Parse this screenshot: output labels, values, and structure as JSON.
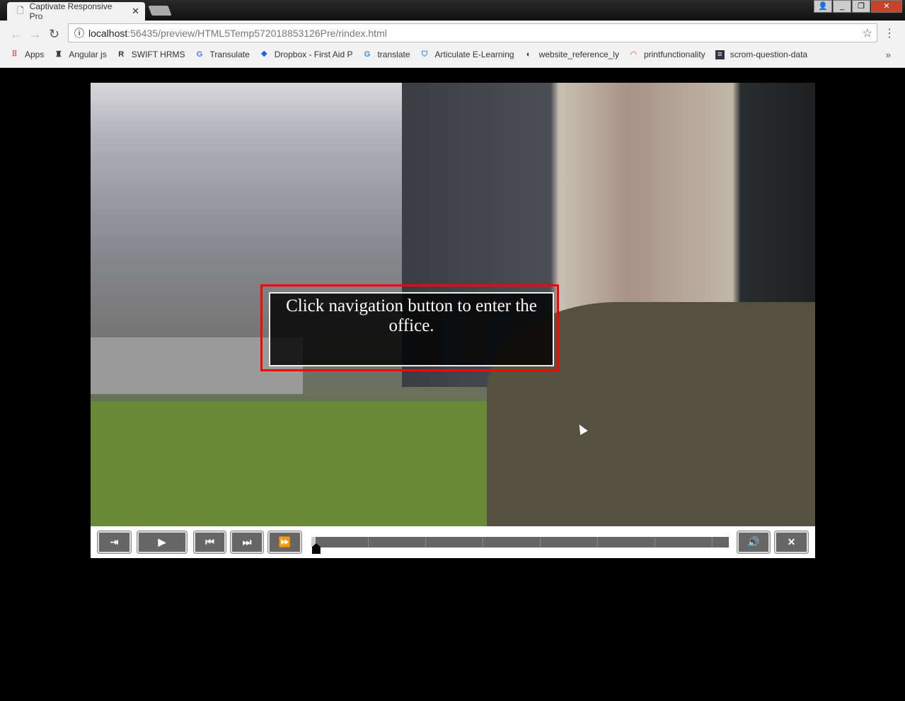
{
  "browser": {
    "tab_title": "Captivate Responsive Pro",
    "url_host": "localhost",
    "url_path": ":56435/preview/HTML5Temp572018853126Pre/rindex.html",
    "bookmarks": [
      {
        "label": "Apps",
        "icon": "apps-grid-icon"
      },
      {
        "label": "Angular js",
        "icon": "angular-icon"
      },
      {
        "label": "SWIFT HRMS",
        "icon": "r-icon"
      },
      {
        "label": "Transulate",
        "icon": "google-icon"
      },
      {
        "label": "Dropbox - First Aid P",
        "icon": "dropbox-icon"
      },
      {
        "label": "translate",
        "icon": "google-icon"
      },
      {
        "label": "Articulate E-Learning",
        "icon": "shield-icon"
      },
      {
        "label": "website_reference_ly",
        "icon": "globe-icon"
      },
      {
        "label": "printfunctionality",
        "icon": "rainbow-icon"
      },
      {
        "label": "scrom-question-data",
        "icon": "doc-icon"
      }
    ]
  },
  "slide": {
    "caption": "Click navigation button to enter the office.",
    "caption_border_color": "#ff0000"
  },
  "playbar": {
    "progress_percent": 1,
    "buttons": [
      "exit-to-toc",
      "play",
      "rewind",
      "forward",
      "fast-forward",
      "audio",
      "close"
    ]
  }
}
